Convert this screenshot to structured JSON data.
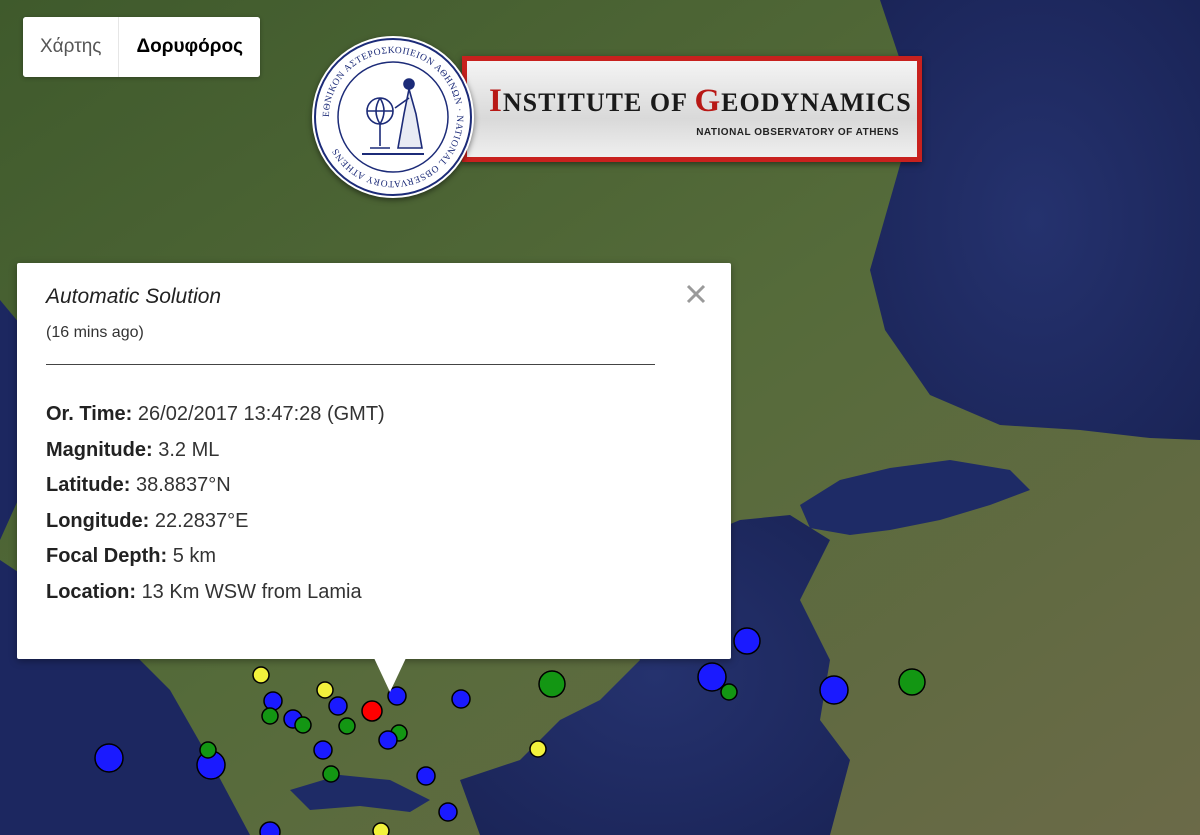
{
  "map_type": {
    "map_label": "Χάρτης",
    "satellite_label": "Δορυφόρος",
    "selected": "Δορυφόρος"
  },
  "logo": {
    "title_initial_1": "I",
    "title_rest_1": "NSTITUTE OF ",
    "title_initial_2": "G",
    "title_rest_2": "EODYNAMICS",
    "subtitle": "NATIONAL OBSERVATORY OF ATHENS",
    "seal_text": "ΕΘΝΙΚΟΝ ΑΣΤΕΡΟΣΚΟΠΕΙΟΝ ΑΘΗΝΩΝ · NATIONAL OBSERVATORY ATHENS",
    "accent_color": "#c8211e"
  },
  "popup": {
    "title": "Automatic Solution",
    "ago": "(16 mins ago)",
    "close_icon": "close-icon",
    "fields": [
      {
        "label": "Or. Time:",
        "value": "26/02/2017  13:47:28 (GMT)"
      },
      {
        "label": "Magnitude:",
        "value": "3.2 ML"
      },
      {
        "label": "Latitude:",
        "value": "38.8837°N"
      },
      {
        "label": "Longitude:",
        "value": "22.2837°E"
      },
      {
        "label": "Focal Depth:",
        "value": "5 km"
      },
      {
        "label": "Location:",
        "value": "13 Km WSW from Lamia"
      }
    ]
  },
  "marker_colors": {
    "selected": "#ff0000",
    "blue": "#1a1aff",
    "green": "#139613",
    "yellow": "#f2f23c"
  }
}
